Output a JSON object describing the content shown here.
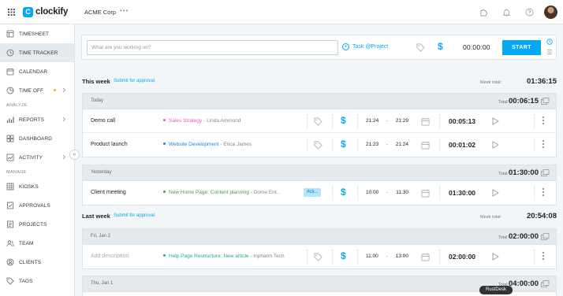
{
  "app": {
    "name": "clockify",
    "workspace": "ACME Corp",
    "workspace_more": "•••"
  },
  "sidebar": {
    "items": [
      {
        "label": "TIMESHEET",
        "icon": "timesheet-icon"
      },
      {
        "label": "TIME TRACKER",
        "icon": "clock-icon",
        "active": true
      },
      {
        "label": "CALENDAR",
        "icon": "calendar-icon"
      },
      {
        "label": "TIME OFF",
        "icon": "time-off-icon"
      }
    ],
    "section_analyze": "ANALYZE",
    "analyze_items": [
      {
        "label": "REPORTS",
        "icon": "reports-icon"
      },
      {
        "label": "DASHBOARD",
        "icon": "dashboard-icon"
      },
      {
        "label": "ACTIVITY",
        "icon": "activity-icon"
      }
    ],
    "section_manage": "MANAGE",
    "manage_items": [
      {
        "label": "KIOSKS",
        "icon": "kiosk-icon"
      },
      {
        "label": "APPROVALS",
        "icon": "approvals-icon"
      },
      {
        "label": "PROJECTS",
        "icon": "projects-icon"
      },
      {
        "label": "TEAM",
        "icon": "team-icon"
      },
      {
        "label": "CLIENTS",
        "icon": "clients-icon"
      },
      {
        "label": "TAGS",
        "icon": "tag-icon"
      }
    ],
    "collapse_glyph": "«"
  },
  "timer": {
    "placeholder": "What are you working on?",
    "task_project": "Task @Project",
    "billable_glyph": "$",
    "time": "00:00:00",
    "start_label": "START"
  },
  "this_week": {
    "title": "This week",
    "submit": "Submit for approval",
    "total_label": "Week total:",
    "total": "01:36:15",
    "days": [
      {
        "label": "Today",
        "total_label": "Total:",
        "total": "00:06:15",
        "entries": [
          {
            "description": "Demo call",
            "project": "Sales Strategy",
            "client": "Linda Ammond",
            "project_color": "#e85eb0",
            "start": "21:24",
            "end": "21:29",
            "duration": "00:05:13"
          },
          {
            "description": "Product launch",
            "project": "Website Development",
            "client": "Erica James",
            "project_color": "#1e88e5",
            "start": "21:23",
            "end": "21:24",
            "duration": "00:01:02"
          }
        ]
      },
      {
        "label": "Yesterday",
        "total_label": "Total:",
        "total": "01:30:00",
        "entries": [
          {
            "description": "Client meeting",
            "project": "New Home Page: Content planning",
            "client": "Dome Ent...",
            "project_color": "#43a047",
            "tag": "#cli...",
            "start": "10:00",
            "end": "11:30",
            "duration": "01:30:00"
          }
        ]
      }
    ]
  },
  "last_week": {
    "title": "Last week",
    "submit": "Submit for approval",
    "total_label": "Week total:",
    "total": "20:54:08",
    "days": [
      {
        "label": "Fri, Jan 2",
        "total_label": "Total:",
        "total": "02:00:00",
        "entries": [
          {
            "description": "Add description",
            "project": "Help Page Restructure: New article",
            "client": "Inpharm Tech",
            "project_color": "#26a69a",
            "start": "11:00",
            "end": "13:00",
            "duration": "02:00:00"
          }
        ]
      },
      {
        "label": "Thu, Jan 1",
        "total_label": "Total:",
        "total": "04:00:00"
      }
    ]
  },
  "range_dash": "-",
  "client_sep": " - ",
  "rustdesk_badge": "RustDesk",
  "colors": {
    "accent": "#03a9f4",
    "sidebar_active": "#e4eaee",
    "day_header": "#e4eaee",
    "background": "#f2f6f8"
  }
}
